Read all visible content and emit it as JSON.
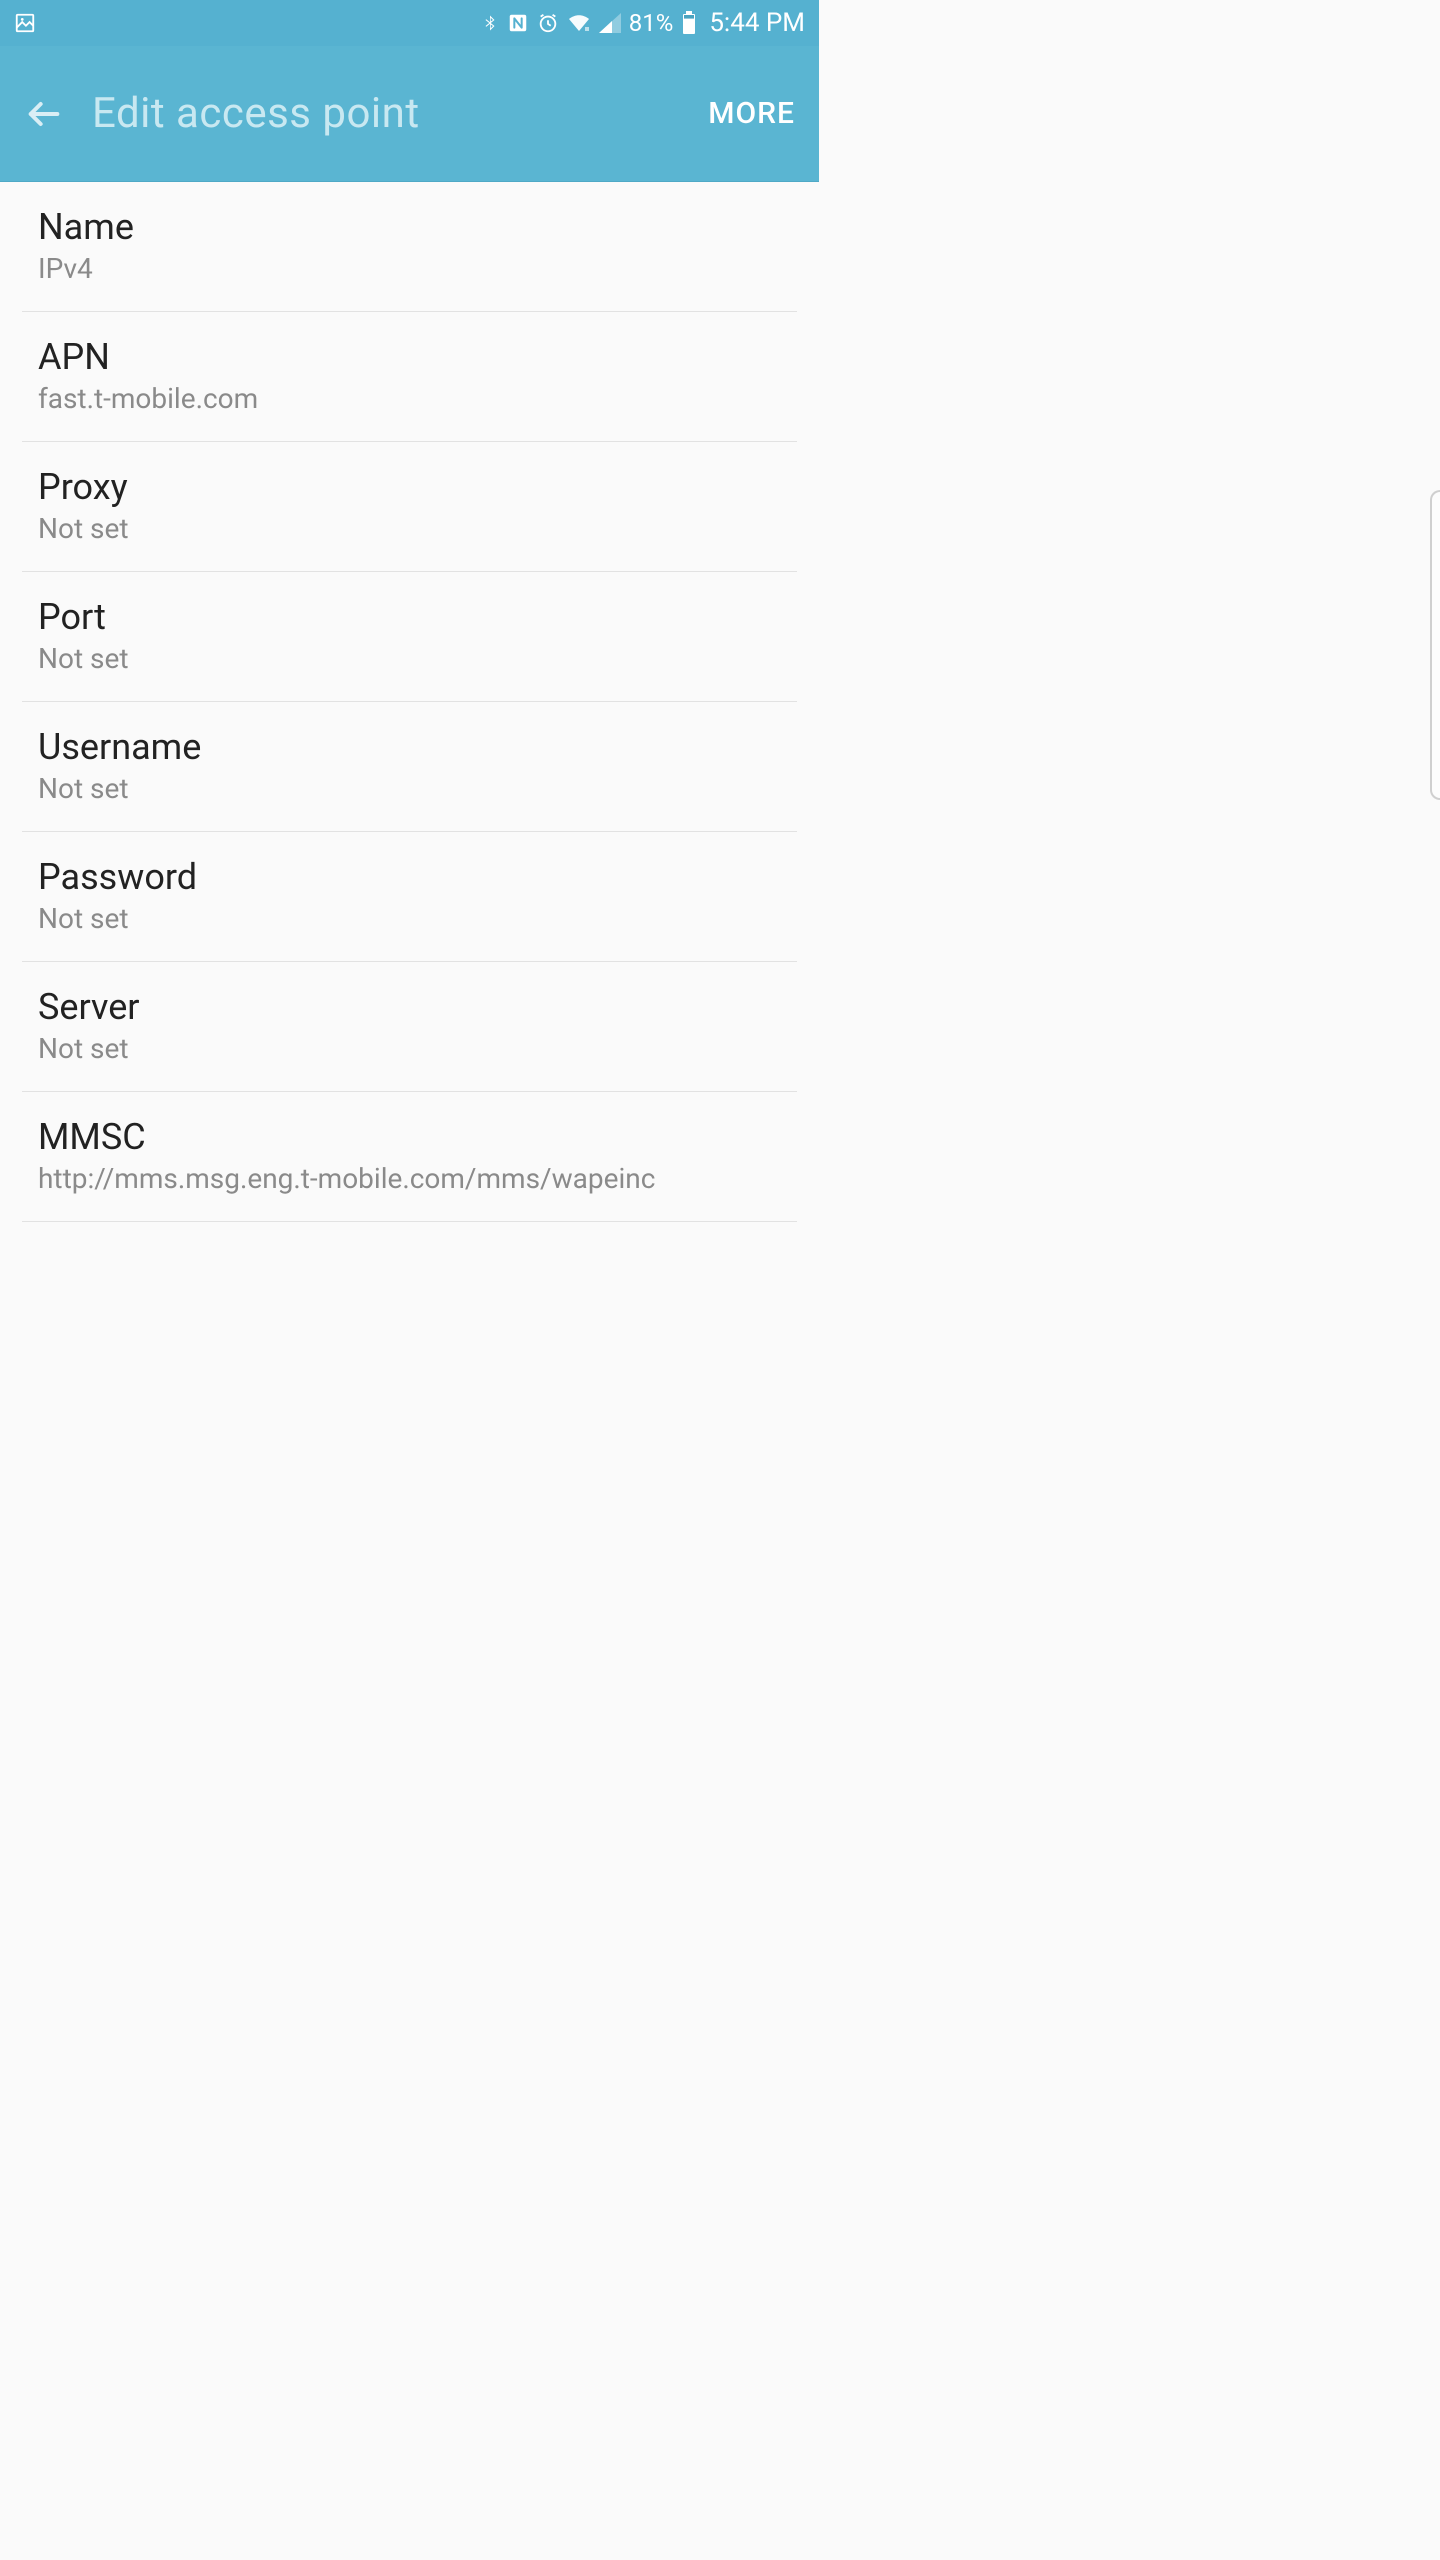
{
  "status": {
    "battery_pct": "81%",
    "time": "5:44 PM"
  },
  "header": {
    "title": "Edit access point",
    "more": "MORE"
  },
  "rows": [
    {
      "label": "Name",
      "value": "IPv4"
    },
    {
      "label": "APN",
      "value": "fast.t-mobile.com"
    },
    {
      "label": "Proxy",
      "value": "Not set"
    },
    {
      "label": "Port",
      "value": "Not set"
    },
    {
      "label": "Username",
      "value": "Not set"
    },
    {
      "label": "Password",
      "value": "Not set"
    },
    {
      "label": "Server",
      "value": "Not set"
    },
    {
      "label": "MMSC",
      "value": "http://mms.msg.eng.t-mobile.com/mms/wapeinc"
    }
  ]
}
